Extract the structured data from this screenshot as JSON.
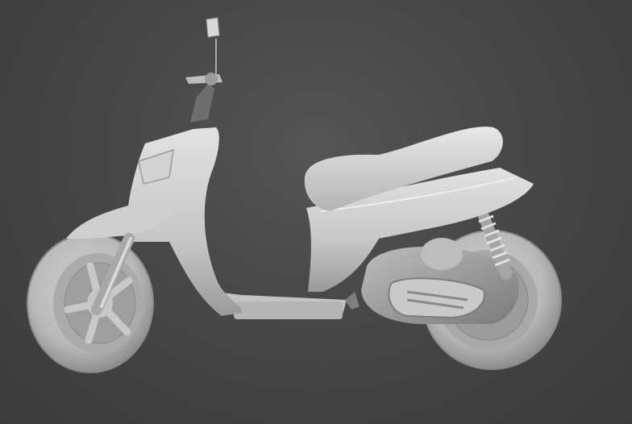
{
  "viewport": {
    "background_color": "#454545",
    "model_color": "#c8c8c8",
    "shadow_color": "#6f6f6f"
  },
  "model": {
    "icon": "scooter-3d-model-icon"
  }
}
